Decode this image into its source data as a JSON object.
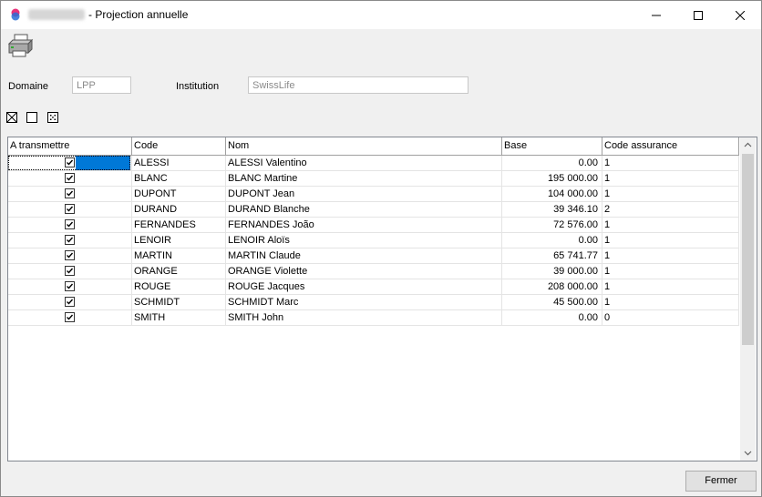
{
  "window": {
    "title_suffix": "- Projection annuelle"
  },
  "form": {
    "domaine_label": "Domaine",
    "domaine_value": "LPP",
    "institution_label": "Institution",
    "institution_value": "SwissLife"
  },
  "grid": {
    "columns": [
      "A transmettre",
      "Code",
      "Nom",
      "Base",
      "Code assurance"
    ],
    "rows": [
      {
        "checked": true,
        "code": "ALESSI",
        "nom": "ALESSI Valentino",
        "base": "0.00",
        "code_assurance": "1"
      },
      {
        "checked": true,
        "code": "BLANC",
        "nom": "BLANC Martine",
        "base": "195 000.00",
        "code_assurance": "1"
      },
      {
        "checked": true,
        "code": "DUPONT",
        "nom": "DUPONT Jean",
        "base": "104 000.00",
        "code_assurance": "1"
      },
      {
        "checked": true,
        "code": "DURAND",
        "nom": "DURAND Blanche",
        "base": "39 346.10",
        "code_assurance": "2"
      },
      {
        "checked": true,
        "code": "FERNANDES",
        "nom": "FERNANDES João",
        "base": "72 576.00",
        "code_assurance": "1"
      },
      {
        "checked": true,
        "code": "LENOIR",
        "nom": "LENOIR Aloïs",
        "base": "0.00",
        "code_assurance": "1"
      },
      {
        "checked": true,
        "code": "MARTIN",
        "nom": "MARTIN Claude",
        "base": "65 741.77",
        "code_assurance": "1"
      },
      {
        "checked": true,
        "code": "ORANGE",
        "nom": "ORANGE Violette",
        "base": "39 000.00",
        "code_assurance": "1"
      },
      {
        "checked": true,
        "code": "ROUGE",
        "nom": "ROUGE Jacques",
        "base": "208 000.00",
        "code_assurance": "1"
      },
      {
        "checked": true,
        "code": "SCHMIDT",
        "nom": "SCHMIDT Marc",
        "base": "45 500.00",
        "code_assurance": "1"
      },
      {
        "checked": true,
        "code": "SMITH",
        "nom": "SMITH John",
        "base": "0.00",
        "code_assurance": "0"
      }
    ]
  },
  "footer": {
    "close_label": "Fermer"
  }
}
